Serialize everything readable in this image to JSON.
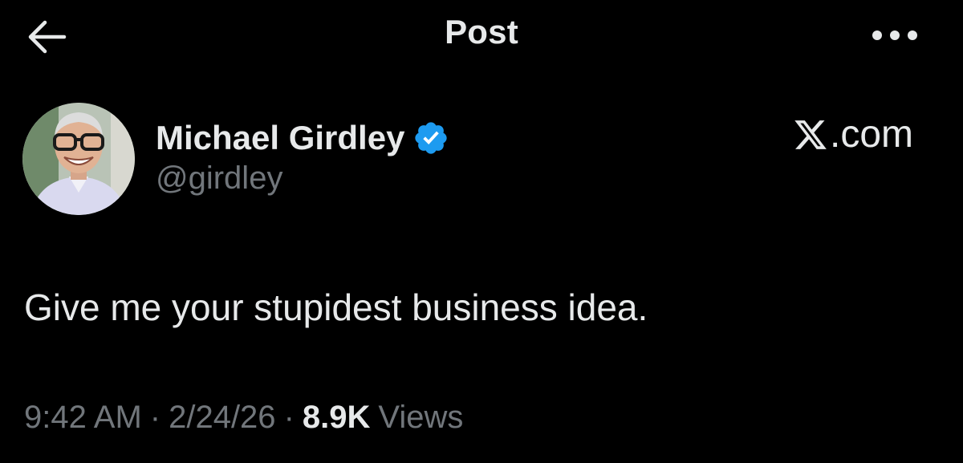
{
  "header": {
    "title": "Post",
    "back_icon": "arrow-left-icon",
    "more_icon": "more-horizontal-icon"
  },
  "author": {
    "display_name": "Michael Girdley",
    "handle": "@girdley",
    "verified_icon": "verified-badge-icon",
    "verified_color": "#1d9bf0"
  },
  "brand": {
    "icon": "x-logo-icon",
    "text": ".com"
  },
  "post": {
    "text": "Give me your stupidest business idea."
  },
  "meta": {
    "time": "9:42 AM",
    "separator": "·",
    "date": "2/24/26",
    "views_count": "8.9K",
    "views_label": "Views"
  },
  "colors": {
    "background": "#000000",
    "primary_text": "#e7e9ea",
    "secondary_text": "#71767b"
  }
}
